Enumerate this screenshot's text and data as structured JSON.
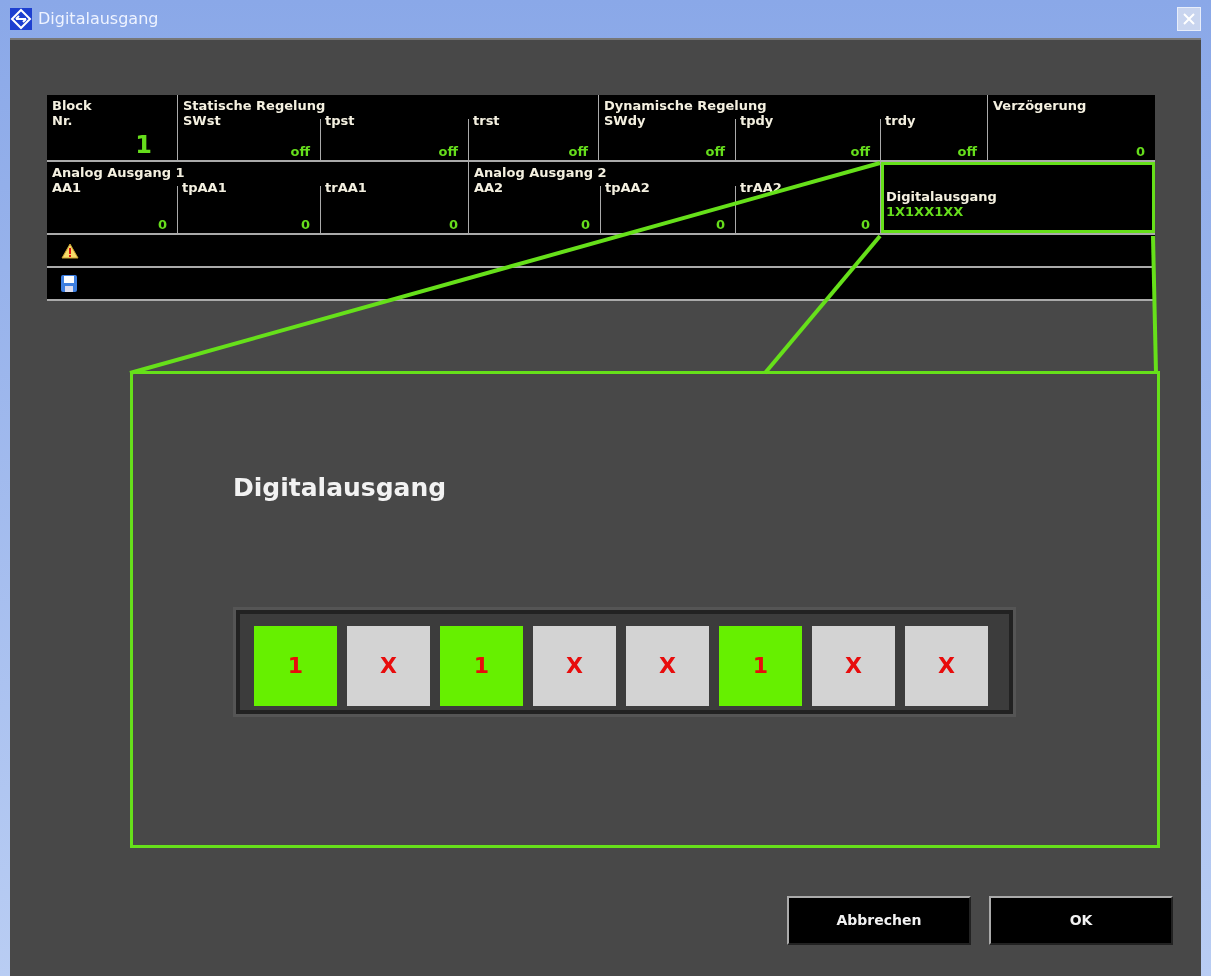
{
  "window": {
    "title": "Digitalausgang"
  },
  "table": {
    "row_1": [
      {
        "group": "Block",
        "cells": [
          {
            "label": "Nr.",
            "value": "1",
            "kind": "block"
          }
        ]
      },
      {
        "group": "Statische Regelung",
        "cells": [
          {
            "label": "SWst",
            "value": "off",
            "kind": "param"
          },
          {
            "label": "tpst",
            "value": "off",
            "kind": "param"
          },
          {
            "label": "trst",
            "value": "off",
            "kind": "param"
          }
        ]
      },
      {
        "group": "Dynamische Regelung",
        "cells": [
          {
            "label": "SWdy",
            "value": "off",
            "kind": "param"
          },
          {
            "label": "tpdy",
            "value": "off",
            "kind": "param"
          },
          {
            "label": "trdy",
            "value": "off",
            "kind": "param"
          }
        ]
      },
      {
        "group": "Verzögerung",
        "cells": [
          {
            "value": "0",
            "kind": "param"
          }
        ]
      }
    ],
    "row_2": [
      {
        "group": "Analog Ausgang 1",
        "cells": [
          {
            "label": "AA1",
            "value": "0",
            "kind": "param"
          },
          {
            "label": "tpAA1",
            "value": "0",
            "kind": "param"
          },
          {
            "label": "trAA1",
            "value": "0",
            "kind": "param"
          }
        ]
      },
      {
        "group": "Analog Ausgang 2",
        "cells": [
          {
            "label": "AA2",
            "value": "0",
            "kind": "param"
          },
          {
            "label": "tpAA2",
            "value": "0",
            "kind": "param"
          },
          {
            "label": "trAA2",
            "value": "0",
            "kind": "param"
          }
        ]
      },
      {
        "cells": [
          {
            "label": "Digitalausgang",
            "value": "1X1XX1XX",
            "kind": "digital",
            "highlighted": true
          }
        ]
      }
    ],
    "status_rows": [
      {
        "kind": "warning"
      },
      {
        "kind": "save"
      }
    ]
  },
  "panel": {
    "title": "Digitalausgang",
    "bits": [
      {
        "label": "1",
        "on": true
      },
      {
        "label": "X",
        "on": false
      },
      {
        "label": "1",
        "on": true
      },
      {
        "label": "X",
        "on": false
      },
      {
        "label": "X",
        "on": false
      },
      {
        "label": "1",
        "on": true
      },
      {
        "label": "X",
        "on": false
      },
      {
        "label": "X",
        "on": false
      }
    ]
  },
  "buttons": [
    "Abbrechen",
    "OK"
  ]
}
